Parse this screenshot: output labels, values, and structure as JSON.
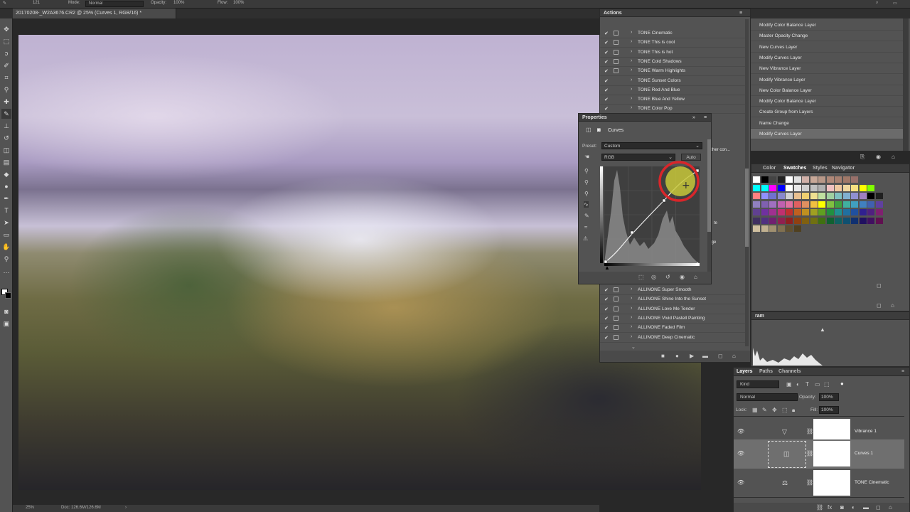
{
  "options_bar": {
    "brush_size": "121",
    "mode_label": "Mode:",
    "mode_value": "Normal",
    "opacity_label": "Opacity:",
    "opacity_value": "100%",
    "flow_label": "Flow:",
    "flow_value": "100%"
  },
  "document": {
    "tab_title": "20170208-_W2A3676.CR2 @ 25% (Curves 1, RGB/16) *",
    "zoom": "25%",
    "doc_size": "Doc: 126.6M/126.6M"
  },
  "actions": {
    "title": "Actions",
    "items_top": [
      "TONE Cinematic",
      "TONE This is cool",
      "TONE This is hot",
      "TONE Cold Shadows",
      "TONE Warm Highlights",
      "TONE Sunset Colors",
      "TONE Red And Blue",
      "TONE Blue And Yellow",
      "TONE Color Pop"
    ],
    "items_bottom": [
      "ALLINONE Super Smooth",
      "ALLINONE Shine Into the Sunset",
      "ALLINONE Love Me Tender",
      "ALLINONE Vivid Pastell Painting",
      "ALLINONE Faded Film",
      "ALLINONE Deep Cinematic"
    ],
    "hidden_fragments": [
      "ather con...",
      "te",
      "ange"
    ]
  },
  "history": {
    "items": [
      "Modify Color Balance Layer",
      "Master Opacity Change",
      "New Curves Layer",
      "Modify Curves Layer",
      "New Vibrance Layer",
      "Modify Vibrance Layer",
      "New Color Balance Layer",
      "Modify Color Balance Layer",
      "Create Group from Layers",
      "Name Change",
      "Modify Curves Layer"
    ],
    "active_index": 10
  },
  "properties": {
    "title": "Properties",
    "panel_type": "Curves",
    "preset_label": "Preset:",
    "preset_value": "Custom",
    "channel": "RGB",
    "auto_label": "Auto"
  },
  "swatches": {
    "tabs": [
      "Color",
      "Swatches",
      "Styles",
      "Navigator"
    ],
    "active_tab": "Swatches"
  },
  "histogram": {
    "title": "ram"
  },
  "layers": {
    "tabs": [
      "Layers",
      "Paths",
      "Channels"
    ],
    "kind_label": "Kind",
    "blend_mode": "Normal",
    "opacity_label": "Opacity:",
    "opacity_value": "100%",
    "lock_label": "Lock:",
    "fill_label": "Fill:",
    "fill_value": "100%",
    "rows": [
      {
        "name": "Vibrance 1",
        "icon": "vibrance-icon"
      },
      {
        "name": "Curves 1",
        "icon": "curves-icon"
      },
      {
        "name": "TONE Cinematic",
        "icon": "color-balance-icon"
      }
    ]
  },
  "colors": {
    "accent_red": "#d9262a",
    "highlight_yellow": "#c8c83a"
  }
}
